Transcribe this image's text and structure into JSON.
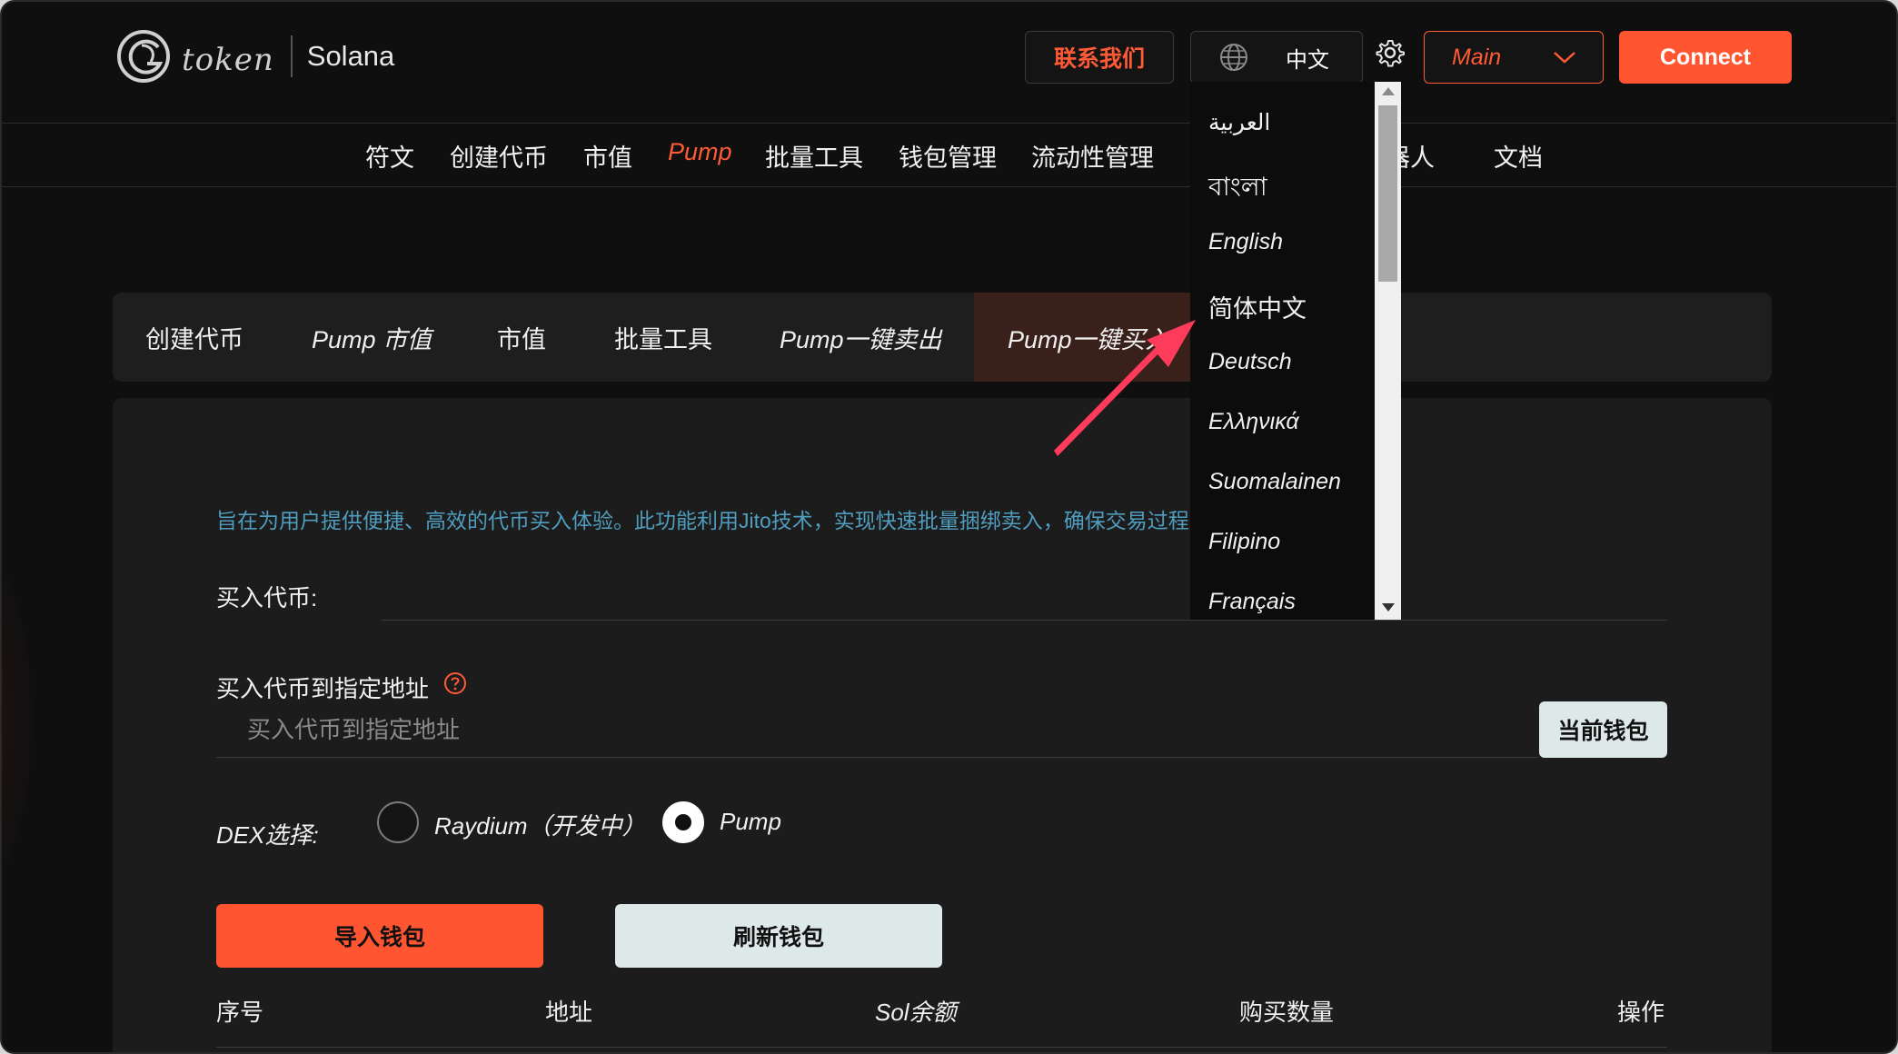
{
  "header": {
    "logo_word": "token",
    "chain": "Solana",
    "contact_label": "联系我们",
    "lang_current": "中文",
    "network": "Main",
    "connect_label": "Connect"
  },
  "nav": {
    "items": [
      "符文",
      "创建代币",
      "市值",
      "Pump",
      "批量工具",
      "钱包管理",
      "流动性管理",
      "机器人",
      "文档"
    ]
  },
  "subtabs": [
    "创建代币",
    "Pump 市值",
    "市值",
    "批量工具",
    "Pump一键卖出",
    "Pump一键买入"
  ],
  "main": {
    "description": "旨在为用户提供便捷、高效的代币买入体验。此功能利用Jito技术，实现快速批量捆绑卖入，确保交易过程",
    "buy_token_label": "买入代币:",
    "buy_addr_label": "买入代币到指定地址",
    "buy_addr_placeholder": "买入代币到指定地址",
    "current_wallet_label": "当前钱包",
    "dex_label": "DEX选择:",
    "dex_options": [
      "Raydium（开发中）",
      "Pump"
    ],
    "dex_selected": "Pump",
    "import_wallet_label": "导入钱包",
    "refresh_wallet_label": "刷新钱包",
    "table_headers": [
      "序号",
      "地址",
      "Sol余额",
      "购买数量",
      "操作"
    ]
  },
  "language_dropdown": {
    "items": [
      "العربية",
      "বাংলা",
      "English",
      "简体中文",
      "Deutsch",
      "Ελληνικά",
      "Suomalainen",
      "Filipino",
      "Français"
    ]
  },
  "colors": {
    "accent": "#ff5530",
    "background": "#0f0f0f",
    "panel": "#1c1c1c",
    "light_button": "#dde9e9",
    "description": "#4f9dbf",
    "arrow": "#ff3b5c"
  }
}
